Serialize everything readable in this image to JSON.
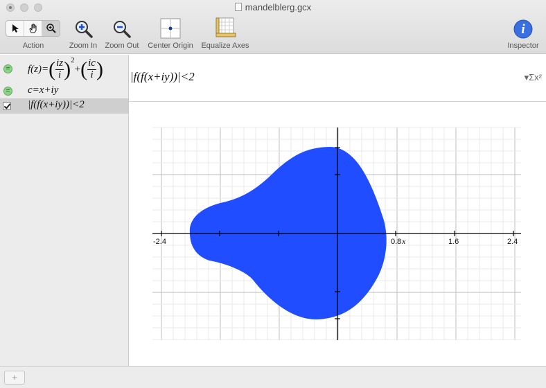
{
  "window": {
    "title": "mandelblerg.gcx"
  },
  "toolbar": {
    "action_label": "Action",
    "zoom_in_label": "Zoom In",
    "zoom_out_label": "Zoom Out",
    "center_origin_label": "Center Origin",
    "equalize_axes_label": "Equalize Axes",
    "inspector_label": "Inspector",
    "inspector_glyph": "i"
  },
  "sidebar": {
    "items": [
      {
        "lhs": "f(z)=",
        "frac1_num": "iz",
        "frac1_den": "i",
        "exp": "2",
        "plus": "+",
        "frac2_num": "ic",
        "frac2_den": "i",
        "badge": "="
      },
      {
        "text": "c=x+iy",
        "badge": "="
      },
      {
        "text": "|f(f(x+iy))|<2",
        "checked": true
      }
    ]
  },
  "equation_bar": {
    "text": "|f(f(x+iy))|<2",
    "sigma": "▾Σx²"
  },
  "graph": {
    "axis_labels": {
      "x_neg": "-2.4",
      "x_mid": "0.8",
      "x_var": "x",
      "x_1": "1.6",
      "x_2": "2.4"
    },
    "fill_color": "#1f4dff",
    "axis_color": "#000000"
  },
  "bottom": {
    "add_label": "+"
  }
}
